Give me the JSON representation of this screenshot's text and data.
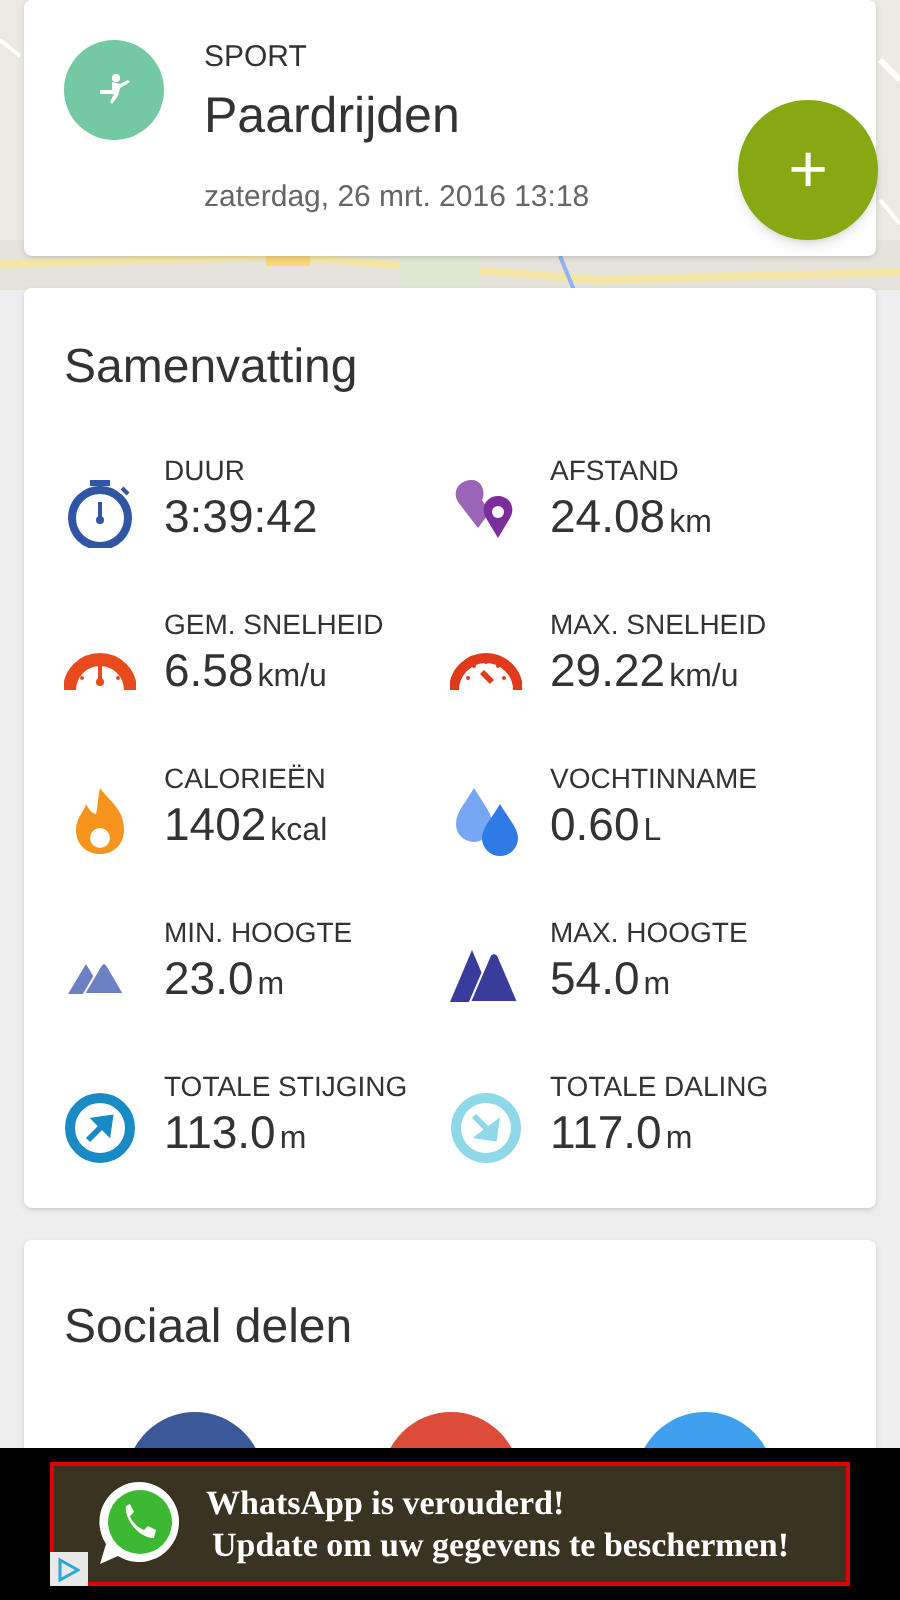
{
  "activity": {
    "category": "SPORT",
    "name": "Paardrijden",
    "datetime": "zaterdag, 26 mrt. 2016 13:18",
    "add_button": "+"
  },
  "summary": {
    "title": "Samenvatting",
    "stats": [
      {
        "kind": "stopwatch",
        "label": "DUUR",
        "value": "3:39:42"
      },
      {
        "kind": "pins",
        "label": "AFSTAND",
        "value": "24.08",
        "unit": "km"
      },
      {
        "kind": "gauge-low",
        "label": "GEM. SNELHEID",
        "value": "6.58",
        "unit": "km/u"
      },
      {
        "kind": "gauge-high",
        "label": "MAX. SNELHEID",
        "value": "29.22",
        "unit": "km/u"
      },
      {
        "kind": "flame",
        "label": "CALORIEËN",
        "value": "1402",
        "unit": "kcal"
      },
      {
        "kind": "drops",
        "label": "VOCHTINNAME",
        "value": "0.60",
        "unit": "L"
      },
      {
        "kind": "mountains-light",
        "label": "MIN. HOOGTE",
        "value": "23.0",
        "unit": "m"
      },
      {
        "kind": "mountains-dark",
        "label": "MAX. HOOGTE",
        "value": "54.0",
        "unit": "m"
      },
      {
        "kind": "ascent",
        "label": "TOTALE STIJGING",
        "value": "113.0",
        "unit": "m"
      },
      {
        "kind": "descent",
        "label": "TOTALE DALING",
        "value": "117.0",
        "unit": "m"
      }
    ]
  },
  "social": {
    "title": "Sociaal delen",
    "buttons": [
      {
        "color": "#3b5998"
      },
      {
        "color": "#dd4b39"
      },
      {
        "color": "#3fa0f0"
      }
    ]
  },
  "ad": {
    "line_1": "WhatsApp is verouderd!",
    "line_2": "Update om uw gegevens te beschermen!"
  }
}
